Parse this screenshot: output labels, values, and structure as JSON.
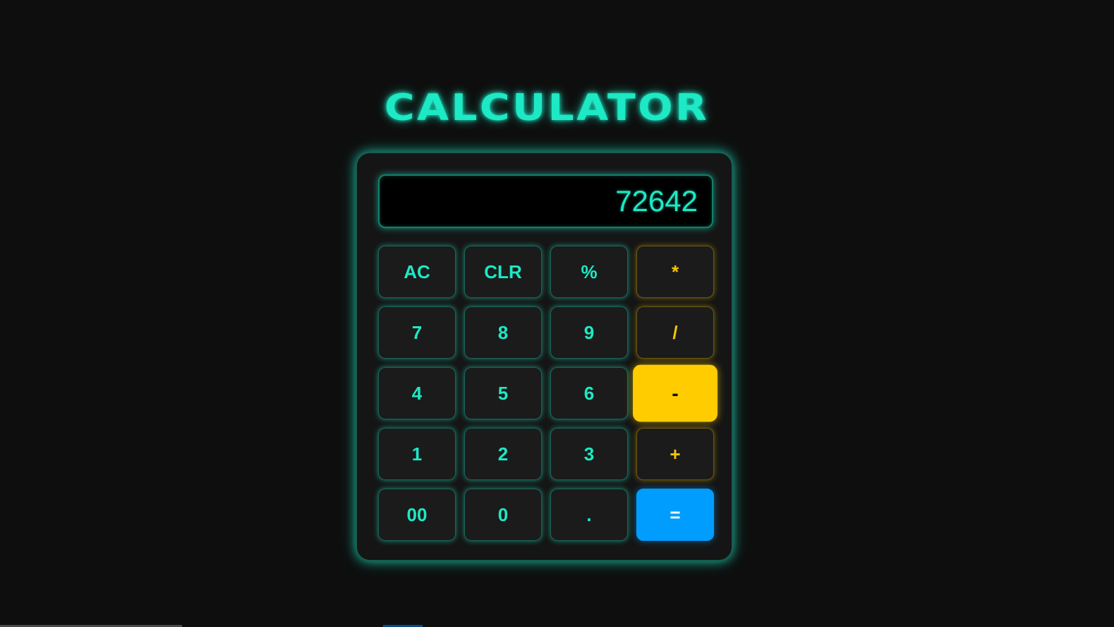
{
  "title": "CALCULATOR",
  "display": {
    "value": "72642"
  },
  "colors": {
    "accent": "#1de9c5",
    "operator": "#f7c600",
    "operator_active_bg": "#ffcc00",
    "equals_bg": "#009dff",
    "background": "#0e0e0e"
  },
  "keys": [
    {
      "label": "AC",
      "type": "function"
    },
    {
      "label": "CLR",
      "type": "function"
    },
    {
      "label": "%",
      "type": "function"
    },
    {
      "label": "*",
      "type": "operator"
    },
    {
      "label": "7",
      "type": "digit"
    },
    {
      "label": "8",
      "type": "digit"
    },
    {
      "label": "9",
      "type": "digit"
    },
    {
      "label": "/",
      "type": "operator"
    },
    {
      "label": "4",
      "type": "digit"
    },
    {
      "label": "5",
      "type": "digit"
    },
    {
      "label": "6",
      "type": "digit"
    },
    {
      "label": "-",
      "type": "operator",
      "active": true
    },
    {
      "label": "1",
      "type": "digit"
    },
    {
      "label": "2",
      "type": "digit"
    },
    {
      "label": "3",
      "type": "digit"
    },
    {
      "label": "+",
      "type": "operator"
    },
    {
      "label": "00",
      "type": "digit"
    },
    {
      "label": "0",
      "type": "digit"
    },
    {
      "label": ".",
      "type": "digit"
    },
    {
      "label": "=",
      "type": "equals"
    }
  ]
}
